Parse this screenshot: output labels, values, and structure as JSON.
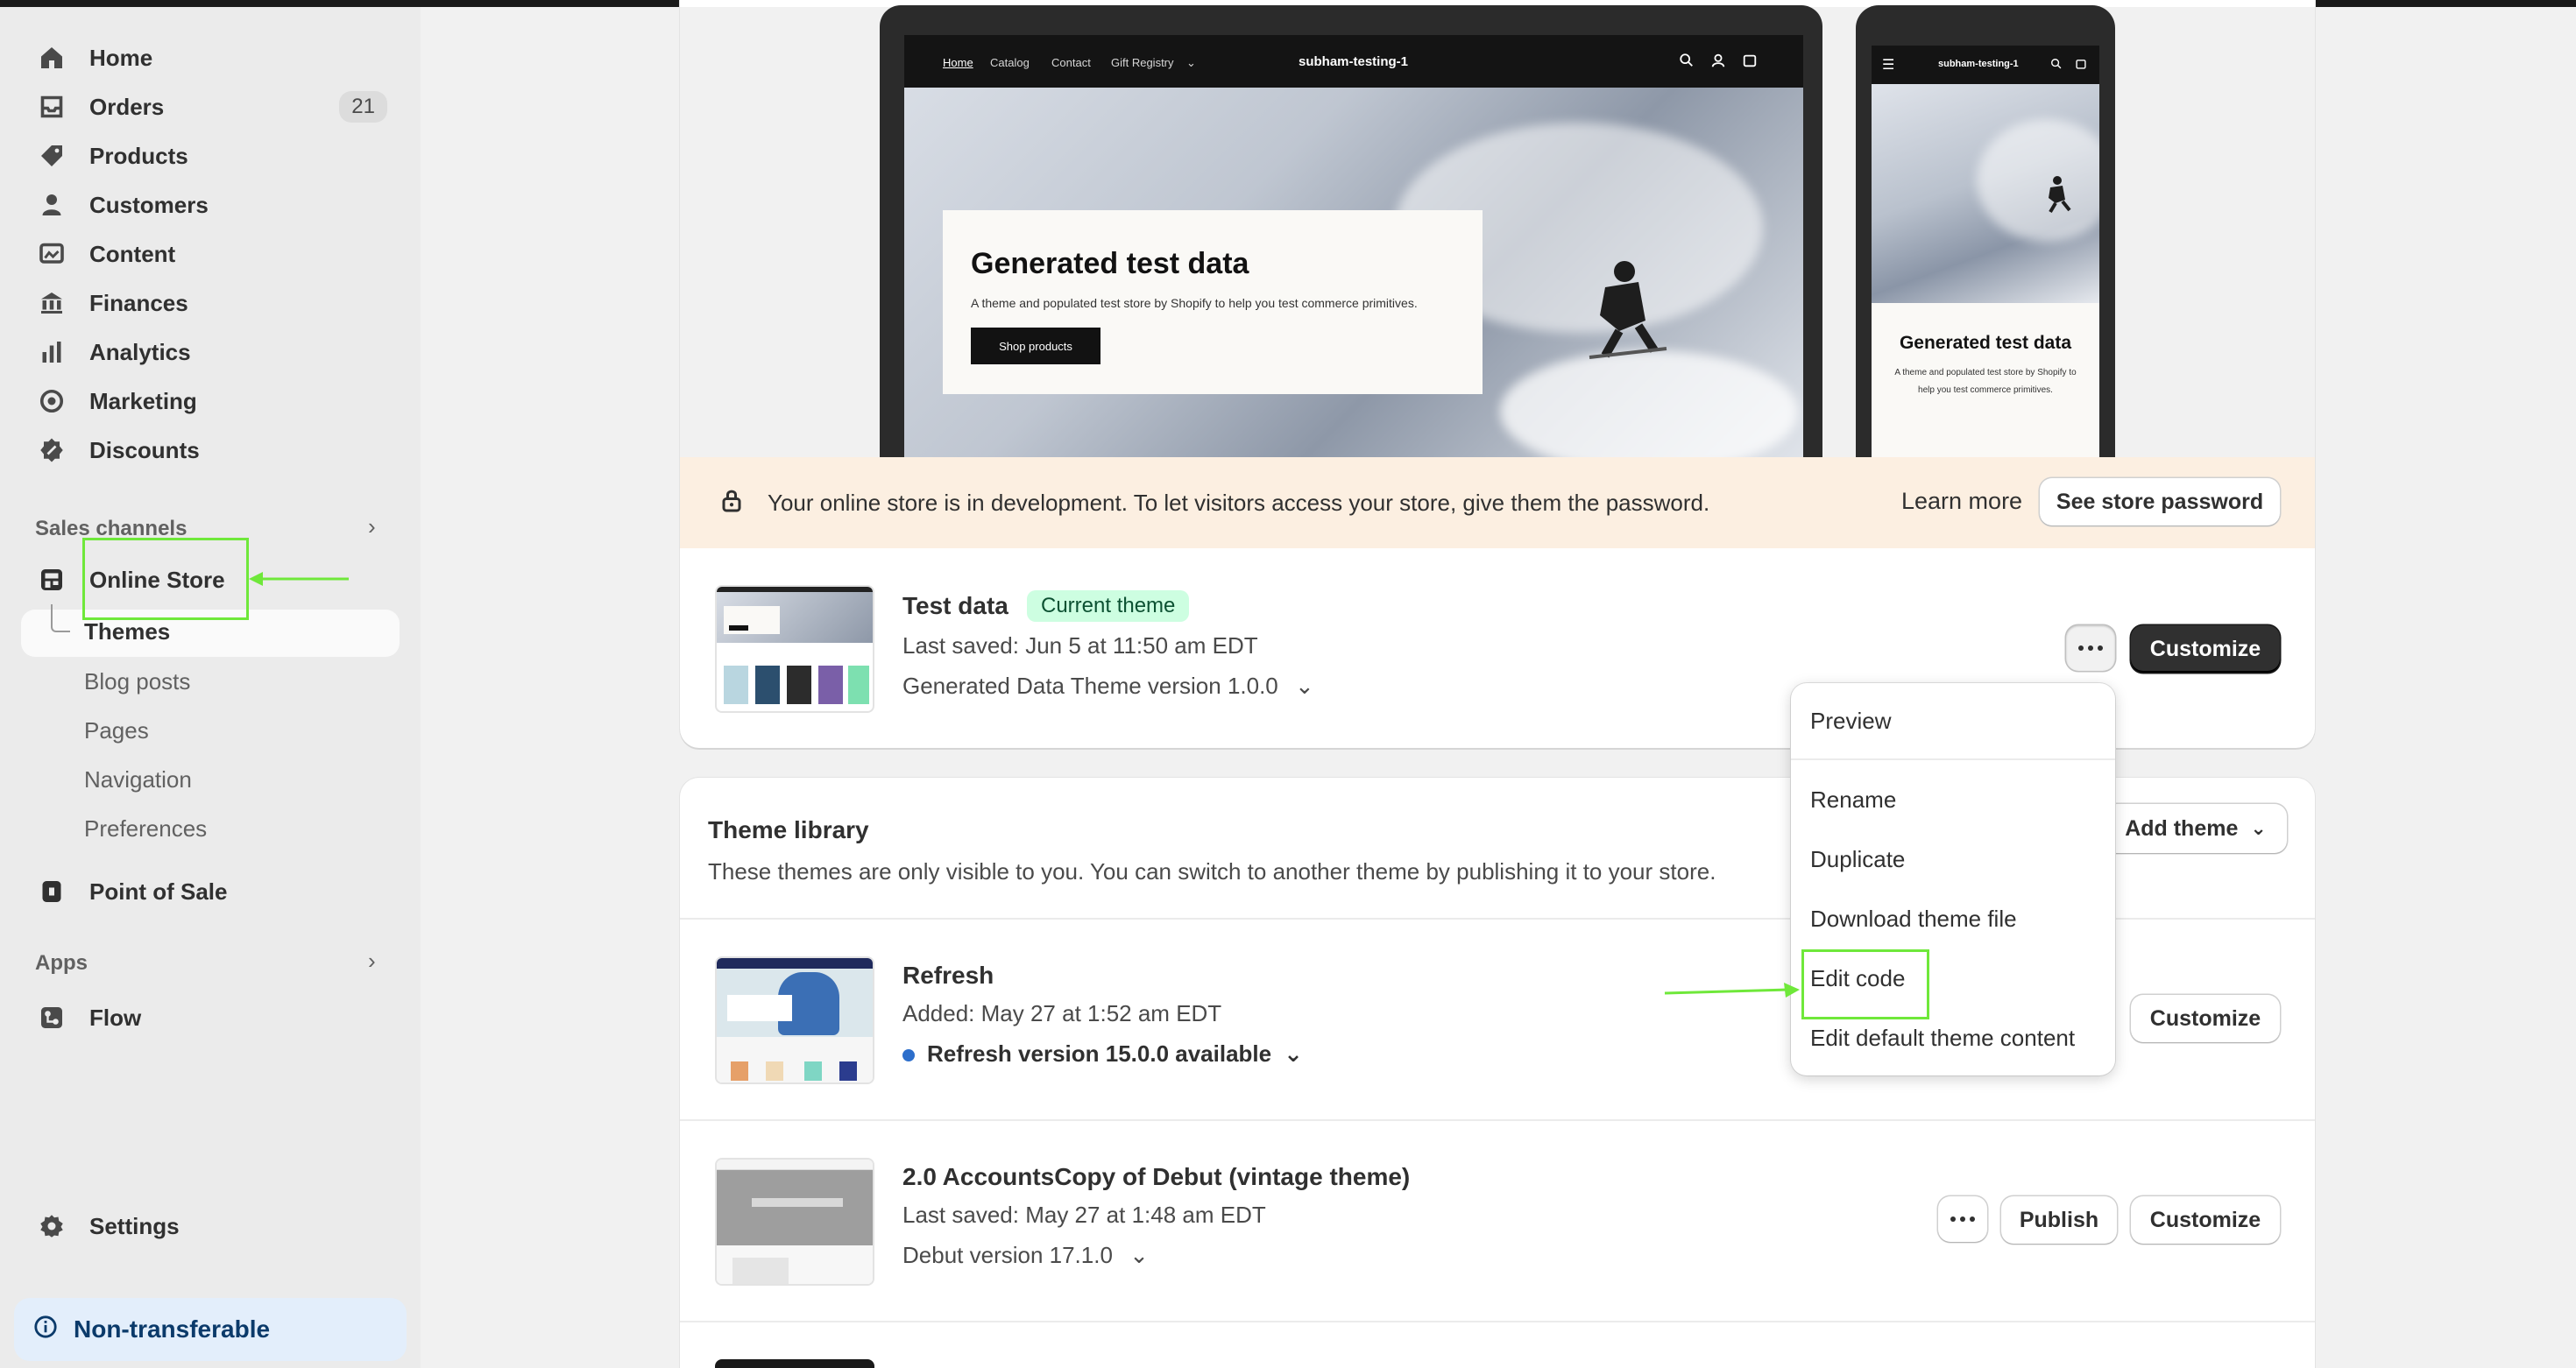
{
  "sidebar": {
    "nav": [
      {
        "label": "Home",
        "icon": "home-icon"
      },
      {
        "label": "Orders",
        "icon": "inbox-icon",
        "badge": "21"
      },
      {
        "label": "Products",
        "icon": "tag-icon"
      },
      {
        "label": "Customers",
        "icon": "person-icon"
      },
      {
        "label": "Content",
        "icon": "image-icon"
      },
      {
        "label": "Finances",
        "icon": "bank-icon"
      },
      {
        "label": "Analytics",
        "icon": "bar-chart-icon"
      },
      {
        "label": "Marketing",
        "icon": "target-icon"
      },
      {
        "label": "Discounts",
        "icon": "discount-icon"
      }
    ],
    "sales_channels_label": "Sales channels",
    "online_store": "Online Store",
    "sub_items": [
      "Themes",
      "Blog posts",
      "Pages",
      "Navigation",
      "Preferences"
    ],
    "point_of_sale": "Point of Sale",
    "apps_label": "Apps",
    "flow": "Flow",
    "settings": "Settings",
    "non_transferable": "Non-transferable"
  },
  "preview": {
    "desktop_nav": [
      "Home",
      "Catalog",
      "Contact",
      "Gift Registry"
    ],
    "store_name": "subham-testing-1",
    "hero_title": "Generated test data",
    "hero_text": "A theme and populated test store by Shopify to help you test commerce primitives.",
    "hero_button": "Shop products",
    "mobile_hero_title": "Generated test data",
    "mobile_hero_text": "A theme and populated test store by Shopify to help you test commerce primitives."
  },
  "banner": {
    "text": "Your online store is in development. To let visitors access your store, give them the password.",
    "learn_more": "Learn more",
    "button": "See store password"
  },
  "current_theme": {
    "name": "Test data",
    "badge": "Current theme",
    "saved": "Last saved: Jun 5 at 11:50 am EDT",
    "version": "Generated Data Theme version 1.0.0",
    "customize": "Customize"
  },
  "menu": {
    "items": [
      "Preview",
      "Rename",
      "Duplicate",
      "Download theme file",
      "Edit code",
      "Edit default theme content"
    ]
  },
  "library": {
    "title": "Theme library",
    "subtitle": "These themes are only visible to you. You can switch to another theme by publishing it to your store.",
    "add_theme": "Add theme",
    "themes": [
      {
        "name": "Refresh",
        "line": "Added: May 27 at 1:52 am EDT",
        "version": "Refresh version 15.0.0 available",
        "customize": "Customize"
      },
      {
        "name": "2.0 AccountsCopy of Debut (vintage theme)",
        "line": "Last saved: May 27 at 1:48 am EDT",
        "version": "Debut version 17.1.0",
        "publish": "Publish",
        "customize": "Customize"
      }
    ]
  },
  "colors": {
    "highlight": "#6fe83a",
    "current_badge_bg": "#cdfee1",
    "banner_bg": "#fcefe1",
    "update_dot": "#2c6ecb"
  }
}
